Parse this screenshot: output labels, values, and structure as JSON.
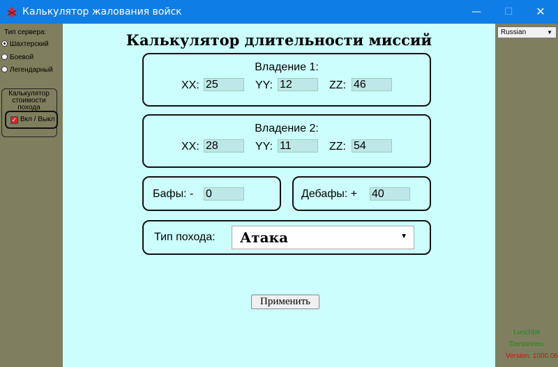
{
  "window": {
    "title": "Калькулятор жалования войск",
    "minimize": "—",
    "maximize": "☐",
    "close": "✕"
  },
  "sidebar": {
    "server_label": "Тип сервера:",
    "servers": [
      {
        "label": "Шахтерский",
        "selected": true
      },
      {
        "label": "Боевой",
        "selected": false
      },
      {
        "label": "Легендарный",
        "selected": false
      }
    ],
    "cost_calc": {
      "title": "Калькулятор стоимости похода",
      "toggle_label": "Вкл / Выкл",
      "checked": true
    }
  },
  "language": {
    "selected": "Russian"
  },
  "footer": {
    "credit1": "Lunchbit",
    "credit2": "Dantanneu",
    "version": "Version: 1000.06"
  },
  "main": {
    "title": "Калькулятор длительности миссий",
    "holding1": {
      "title": "Владение 1:",
      "xx": "25",
      "yy": "12",
      "zz": "46"
    },
    "holding2": {
      "title": "Владение 2:",
      "xx": "28",
      "yy": "11",
      "zz": "54"
    },
    "axis": {
      "xx": "XX:",
      "yy": "YY:",
      "zz": "ZZ:"
    },
    "buffs": {
      "label": "Бафы: -",
      "value": "0"
    },
    "debuffs": {
      "label": "Дебафы: +",
      "value": "40"
    },
    "march": {
      "label": "Тип похода:",
      "selected": "Атака"
    },
    "apply_label": "Применить"
  },
  "colors": {
    "titlebar": "#0f7de6",
    "main_bg": "#ccfefe",
    "side_bg": "#7f7f5f",
    "field_bg": "#bee7e7"
  }
}
